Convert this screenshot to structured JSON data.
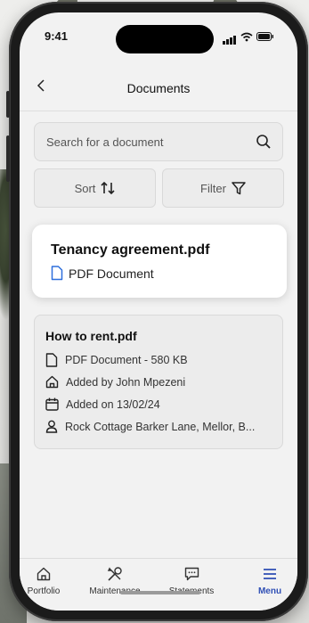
{
  "status": {
    "time": "9:41"
  },
  "nav": {
    "title": "Documents",
    "back_icon": "chevron-left-icon"
  },
  "search": {
    "placeholder": "Search for a document"
  },
  "actions": {
    "sort_label": "Sort",
    "filter_label": "Filter"
  },
  "documents": [
    {
      "name": "Tenancy agreement.pdf",
      "type": "PDF Document"
    },
    {
      "name": "How to rent.pdf",
      "details": [
        {
          "icon": "file-icon",
          "text": "PDF Document - 580 KB"
        },
        {
          "icon": "home-icon",
          "text": "Added by John Mpezeni"
        },
        {
          "icon": "calendar-icon",
          "text": "Added on 13/02/24"
        },
        {
          "icon": "person-icon",
          "text": "Rock Cottage Barker Lane, Mellor, B..."
        }
      ]
    }
  ],
  "tabs": [
    {
      "label": "Portfolio",
      "icon": "home-icon"
    },
    {
      "label": "Maintenance",
      "icon": "tools-icon"
    },
    {
      "label": "Statements",
      "icon": "chat-icon"
    },
    {
      "label": "Menu",
      "icon": "menu-icon",
      "active": true
    }
  ],
  "colors": {
    "accent": "#2f4fb5",
    "doc_icon": "#2f6fdc"
  }
}
